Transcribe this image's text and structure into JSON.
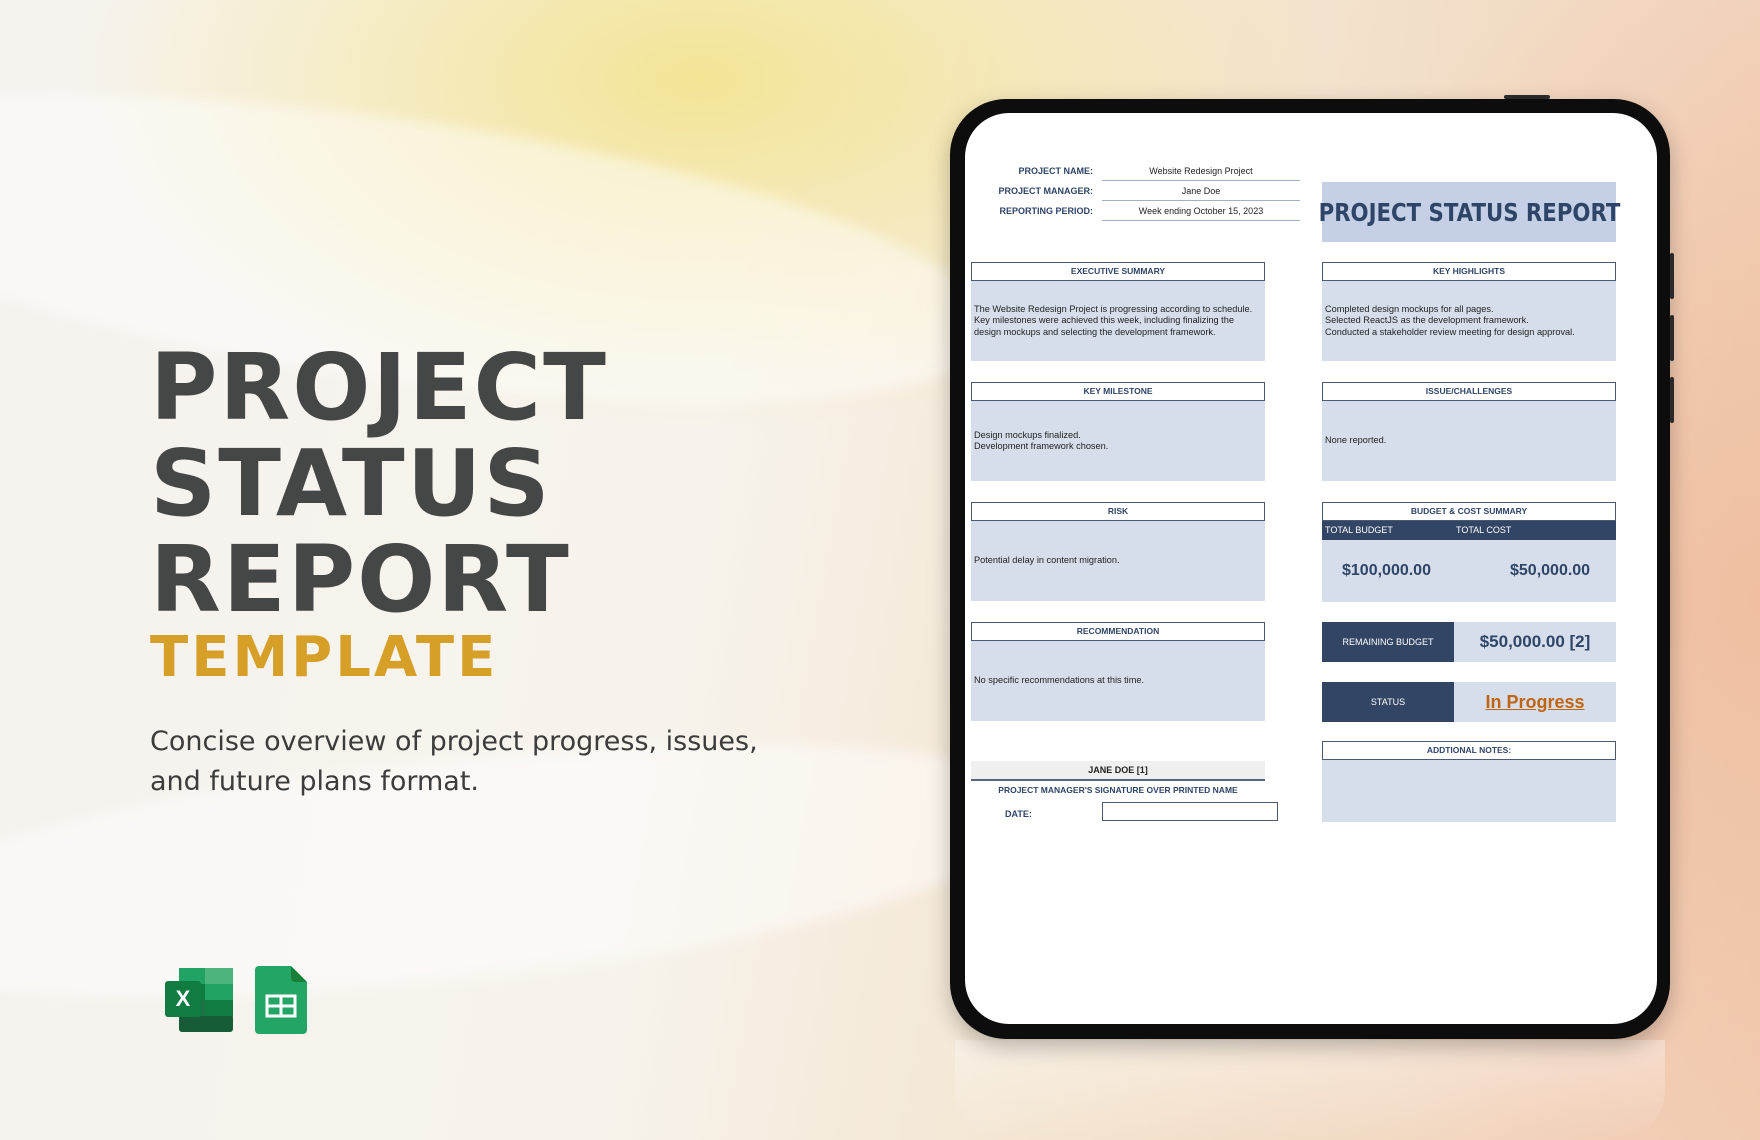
{
  "hero": {
    "title_lines": [
      "PROJECT",
      "STATUS",
      "REPORT"
    ],
    "subtitle": "TEMPLATE",
    "description": "Concise overview of project progress, issues, and future plans format.",
    "accent_color": "#d69f28"
  },
  "app_icons": [
    {
      "name": "excel-icon",
      "letter": "X"
    },
    {
      "name": "google-sheets-icon"
    }
  ],
  "report": {
    "title": "PROJECT STATUS REPORT",
    "header_fields": [
      {
        "label": "PROJECT NAME:",
        "value": "Website Redesign Project"
      },
      {
        "label": "PROJECT MANAGER:",
        "value": "Jane Doe"
      },
      {
        "label": "REPORTING PERIOD:",
        "value": "Week ending October 15, 2023"
      }
    ],
    "sections_left": [
      {
        "title": "EXECUTIVE SUMMARY",
        "body": "The Website Redesign Project is progressing according to schedule.\nKey milestones were achieved this week, including finalizing the\ndesign mockups and selecting the development framework."
      },
      {
        "title": "KEY MILESTONE",
        "body": "Design mockups finalized.\nDevelopment framework chosen."
      },
      {
        "title": "RISK",
        "body": " Potential delay in content migration."
      },
      {
        "title": "RECOMMENDATION",
        "body": "No specific recommendations at this time."
      }
    ],
    "sections_right": [
      {
        "title": "KEY HIGHLIGHTS",
        "body": "Completed design mockups for all pages.\nSelected ReactJS as the development framework.\nConducted a stakeholder review meeting for design approval."
      },
      {
        "title": "ISSUE/CHALLENGES",
        "body": "None reported."
      }
    ],
    "budget": {
      "title": "BUDGET & COST SUMMARY",
      "total_budget_label": "TOTAL BUDGET",
      "total_cost_label": "TOTAL COST",
      "total_budget": "$100,000.00",
      "total_cost": "$50,000.00"
    },
    "remaining_budget": {
      "label": "REMAINING BUDGET",
      "value": "$50,000.00 [2]"
    },
    "status": {
      "label": "STATUS",
      "value": "In Progress",
      "color": "#c0640f"
    },
    "notes": {
      "title": "ADDTIONAL NOTES:",
      "body": ""
    },
    "signature": {
      "name": "JANE DOE [1]",
      "caption": "PROJECT MANAGER'S SIGNATURE OVER PRINTED NAME",
      "date_label": "DATE:",
      "date_value": ""
    }
  }
}
